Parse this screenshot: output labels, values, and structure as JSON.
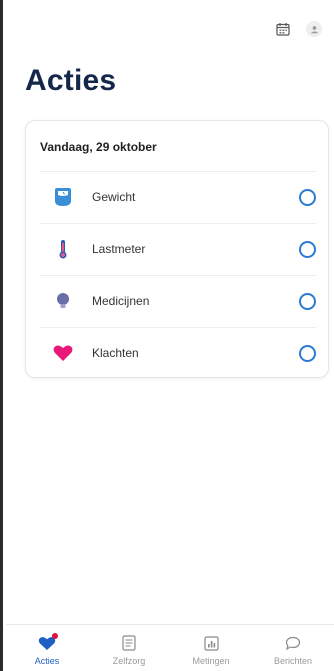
{
  "page": {
    "title": "Acties"
  },
  "topbar": {
    "icons": [
      "calendar-icon",
      "profile-icon"
    ]
  },
  "card": {
    "date": "Vandaag, 29 oktober",
    "items": [
      {
        "label": "Gewicht",
        "icon": "scale-icon",
        "color": "#3a8ed8",
        "done": false
      },
      {
        "label": "Lastmeter",
        "icon": "thermometer-icon",
        "color": "#2a5bb0",
        "done": false
      },
      {
        "label": "Medicijnen",
        "icon": "pill-icon",
        "color": "#6a6fa8",
        "done": false
      },
      {
        "label": "Klachten",
        "icon": "heart-icon",
        "color": "#e8197a",
        "done": false
      }
    ]
  },
  "nav": {
    "items": [
      {
        "label": "Acties",
        "icon": "heart-icon",
        "active": true
      },
      {
        "label": "Zelfzorg",
        "icon": "document-icon",
        "active": false
      },
      {
        "label": "Metingen",
        "icon": "chart-icon",
        "active": false
      },
      {
        "label": "Berichten",
        "icon": "chat-bubble-icon",
        "active": false
      }
    ]
  },
  "colors": {
    "accent": "#1f5fc4",
    "title": "#14264a",
    "radio": "#2a7bd4",
    "badge": "#e0123c"
  }
}
